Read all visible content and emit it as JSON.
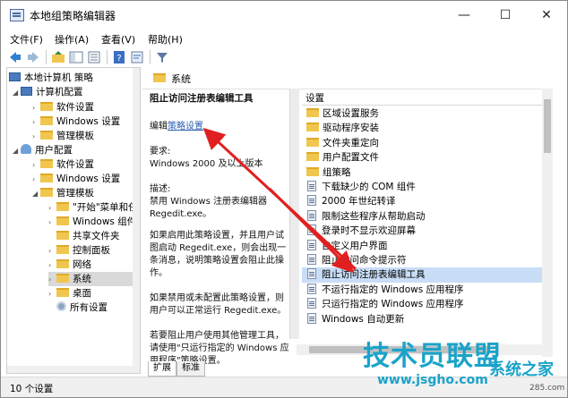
{
  "window": {
    "title": "本地组策略编辑器",
    "minimize": "—",
    "maximize": "☐",
    "close": "✕"
  },
  "menu": [
    "文件(F)",
    "操作(A)",
    "查看(V)",
    "帮助(H)"
  ],
  "tree": {
    "root": "本地计算机 策略",
    "computer_config": "计算机配置",
    "cc_items": [
      "软件设置",
      "Windows 设置",
      "管理模板"
    ],
    "user_config": "用户配置",
    "uc_items": [
      "软件设置",
      "Windows 设置",
      "管理模板"
    ],
    "admin_items": [
      "\"开始\"菜单和任务栏",
      "Windows 组件",
      "共享文件夹",
      "控制面板",
      "网络",
      "系统",
      "桌面",
      "所有设置"
    ]
  },
  "pane": {
    "header": "系统",
    "desc_title": "阻止访问注册表编辑工具",
    "edit_prefix": "编辑",
    "edit_link": "策略设置",
    "req_label": "要求:",
    "req_value": "Windows 2000 及以上版本",
    "desc_label": "描述:",
    "desc_text": "禁用 Windows 注册表编辑器 Regedit.exe。",
    "desc_enabled": "如果启用此策略设置，并且用户试图启动 Regedit.exe，则会出现一条消息，说明策略设置会阻止此操作。",
    "desc_disabled": "如果禁用或未配置此策略设置，则用户可以正常运行 Regedit.exe。",
    "desc_more": "若要阻止用户使用其他管理工具，请使用\"只运行指定的 Windows 应用程序\"策略设置。"
  },
  "list": {
    "header": "设置",
    "folders": [
      "区域设置服务",
      "驱动程序安装",
      "文件夹重定向",
      "用户配置文件",
      "组策略"
    ],
    "policies": [
      "下载缺少的 COM 组件",
      "2000 年世纪转译",
      "限制这些程序从帮助启动",
      "登录时不显示欢迎屏幕",
      "自定义用户界面",
      "阻止访问命令提示符",
      "阻止访问注册表编辑工具",
      "不运行指定的 Windows 应用程序",
      "只运行指定的 Windows 应用程序",
      "Windows 自动更新"
    ],
    "selected_index": 6
  },
  "tabs": [
    "扩展",
    "标准"
  ],
  "status": "10 个设置",
  "watermark": {
    "main": "技术员联盟",
    "sub1": "系统之家",
    "sub2": "www.jsgho.com",
    "sub3": "285.com"
  },
  "colors": {
    "selection": "#c8ddf6",
    "link": "#2a5db0",
    "arrow": "#e02020",
    "watermark": "#1aa3c9"
  }
}
